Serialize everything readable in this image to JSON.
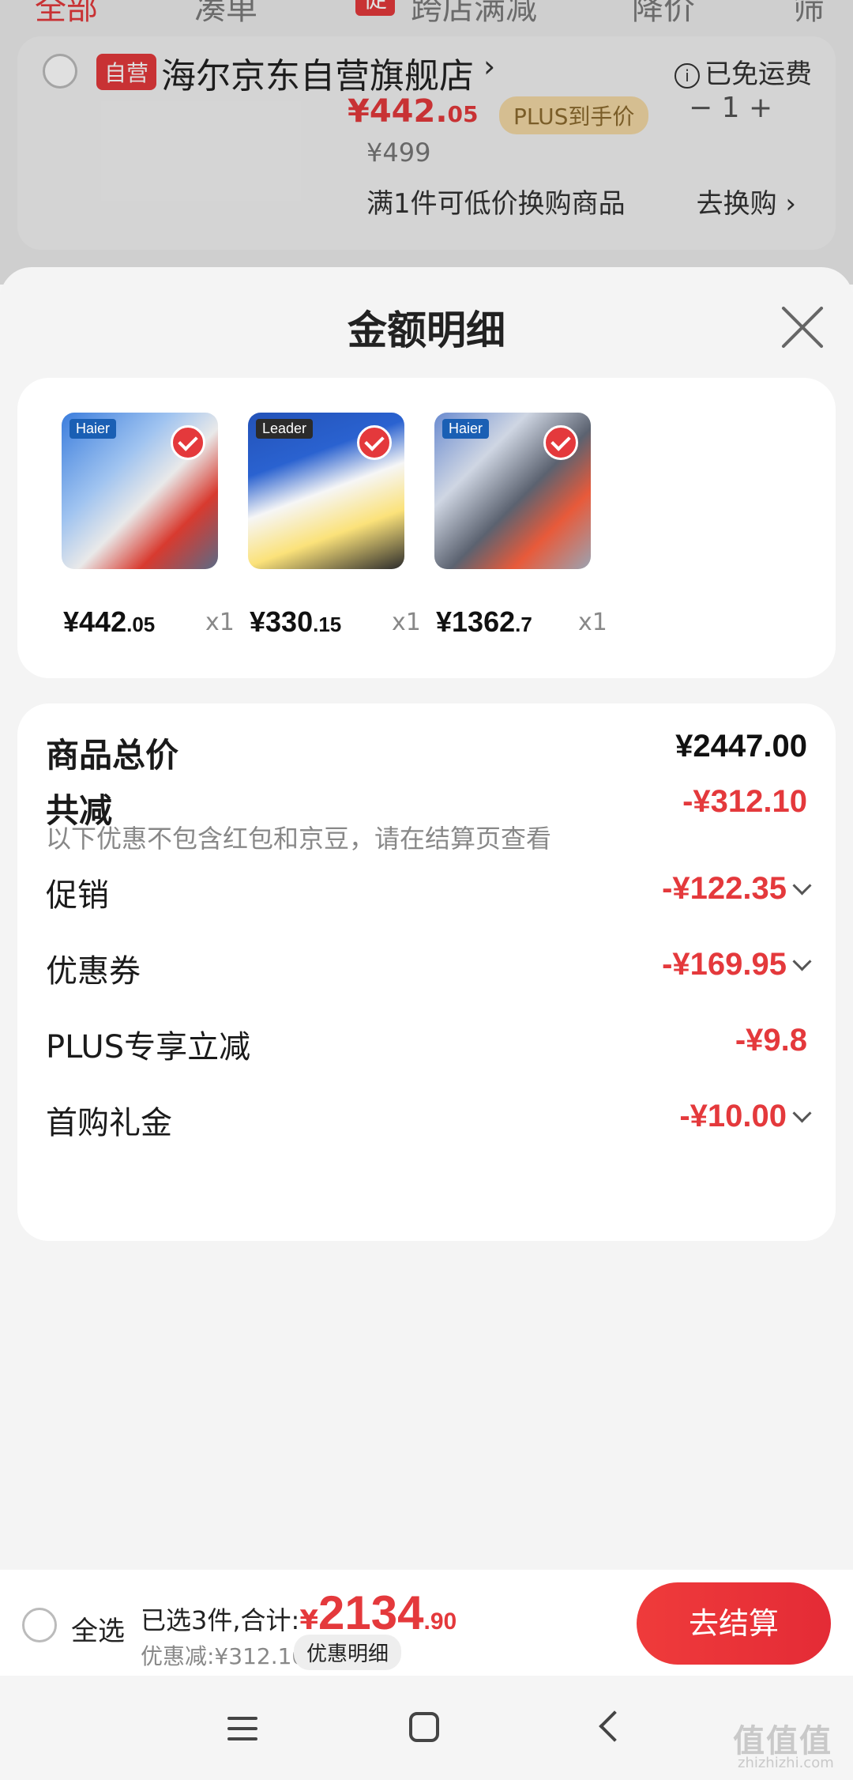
{
  "background": {
    "tabs": [
      {
        "label": "全部",
        "active": true
      },
      {
        "label": "凑单",
        "active": false
      },
      {
        "label": "跨店满减",
        "active": false,
        "badge": "促"
      },
      {
        "label": "降价",
        "active": false
      },
      {
        "label": "筛选",
        "active": false
      }
    ],
    "store": {
      "self_badge": "自营",
      "name": "海尔京东自营旗舰店",
      "arrow": "›",
      "shipping": "已免运费",
      "info_icon": "i"
    },
    "item": {
      "price_int": "¥442.",
      "price_dec": "05",
      "plus_tag": "PLUS到手价",
      "stepper": "−   1   +",
      "original_price": "¥499",
      "swap_text": "满1件可低价换购商品",
      "swap_button": "去换购 ›"
    }
  },
  "sheet": {
    "title": "金额明细",
    "products": [
      {
        "brand": "Haier",
        "price_int": "¥442",
        "price_dec": ".05",
        "qty": "x1",
        "color_a": "#2c6fd6",
        "color_b": "#d83a2f"
      },
      {
        "brand": "Leader",
        "price_int": "¥330",
        "price_dec": ".15",
        "qty": "x1",
        "color_a": "#2352b8",
        "color_b": "#f0c419"
      },
      {
        "brand": "Haier",
        "price_int": "¥1362",
        "price_dec": ".7",
        "qty": "x1",
        "color_a": "#6a8bd0",
        "color_b": "#4b5563"
      }
    ],
    "detail": {
      "total_label": "商品总价",
      "total_value": "¥2447.00",
      "reduce_label": "共减",
      "reduce_value": "-¥312.10",
      "reduce_note": "以下优惠不包含红包和京豆，请在结算页查看",
      "promo_label": "促销",
      "promo_value": "-¥122.35",
      "coupon_label": "优惠券",
      "coupon_value": "-¥169.95",
      "plus_label": "PLUS专享立减",
      "plus_value": "-¥9.8",
      "gift_label": "首购礼金",
      "gift_value": "-¥10.00"
    }
  },
  "checkout": {
    "select_all": "全选",
    "selected_prefix": "已选3件,合计:",
    "currency": "¥",
    "total_int": "2134",
    "total_dec": ".90",
    "discount": "优惠减:¥312.10",
    "detail_chip": "优惠明细",
    "pay_button": "去结算"
  },
  "watermark": {
    "text": "值值值",
    "sub": "zhizhizhi.com"
  },
  "colors": {
    "accent": "#e4393c",
    "sheet_bg": "#f4f4f4",
    "card_bg": "#ffffff"
  }
}
